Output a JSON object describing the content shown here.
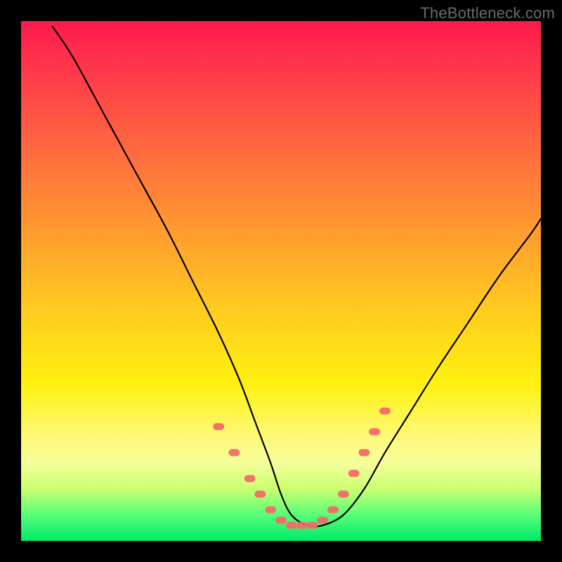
{
  "watermark": "TheBottleneck.com",
  "colors": {
    "frame": "#000000",
    "curve": "#000000",
    "marker": "#f46a6a",
    "gradient_top": "#ff1a4d",
    "gradient_bottom": "#00e86b"
  },
  "chart_data": {
    "type": "line",
    "title": "",
    "xlabel": "",
    "ylabel": "",
    "xlim": [
      0,
      100
    ],
    "ylim": [
      0,
      100
    ],
    "grid": false,
    "legend_position": "none",
    "series": [
      {
        "name": "bottleneck-curve",
        "x": [
          6,
          10,
          16,
          22,
          28,
          33,
          38,
          42,
          45,
          48,
          50,
          52,
          55,
          58,
          62,
          66,
          70,
          75,
          80,
          86,
          92,
          98,
          100
        ],
        "values": [
          99,
          93,
          82,
          71,
          60,
          50,
          40,
          31,
          23,
          15,
          9,
          5,
          3,
          3,
          5,
          10,
          17,
          25,
          33,
          42,
          51,
          59,
          62
        ]
      }
    ],
    "markers": {
      "name": "highlighted-points",
      "x": [
        38,
        41,
        44,
        46,
        48,
        50,
        52,
        54,
        56,
        58,
        60,
        62,
        64,
        66,
        68,
        70
      ],
      "values": [
        22,
        17,
        12,
        9,
        6,
        4,
        3,
        3,
        3,
        4,
        6,
        9,
        13,
        17,
        21,
        25
      ],
      "style": "pill",
      "color": "#f46a6a"
    }
  }
}
